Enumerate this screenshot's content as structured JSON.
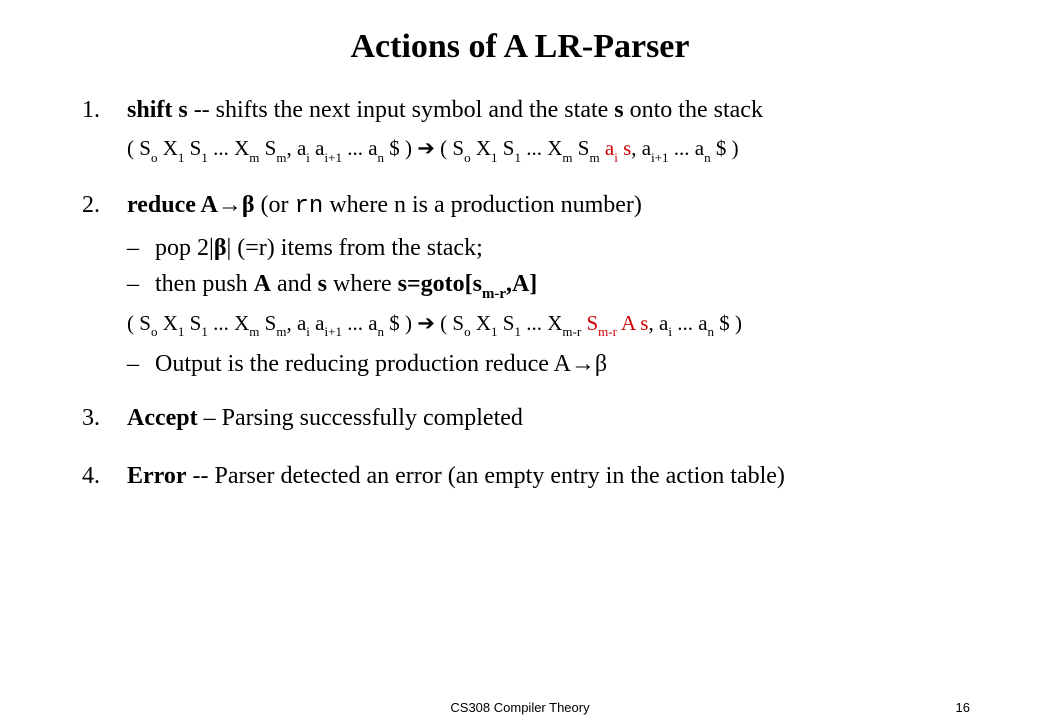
{
  "title": "Actions of A LR-Parser",
  "items": {
    "n1": "1.",
    "shift_bold": "shift s",
    "shift_rest": "  -- shifts the next input symbol and the state ",
    "shift_s": "s",
    "shift_tail": " onto the stack",
    "n2": "2.",
    "reduce_bold": "reduce A",
    "reduce_mid": "   (or ",
    "reduce_rn": "rn",
    "reduce_tail": " where n is a production number)",
    "sub_pop_a": "pop 2|",
    "sub_pop_b": "|  (=r) items from the stack;",
    "sub_push_a": "then push ",
    "sub_push_a2": "A",
    "sub_push_a3": " and ",
    "sub_push_a4": "s",
    "sub_push_a5": "  where  ",
    "sub_push_a6": "s=goto[s",
    "sub_push_a7": ",A]",
    "sub_out_a": "Output is the reducing production reduce A",
    "n3": "3.",
    "accept_bold": "Accept",
    "accept_rest": " – Parsing successfully completed",
    "n4": "4.",
    "error_bold": "Error",
    "error_rest": "  -- Parser detected an error (an empty entry in the action table)"
  },
  "glyph": {
    "beta": "β",
    "rarrow": "→",
    "barrow": "➔",
    "dash": "–"
  },
  "footer": {
    "center": "CS308 Compiler Theory",
    "page": "16"
  }
}
